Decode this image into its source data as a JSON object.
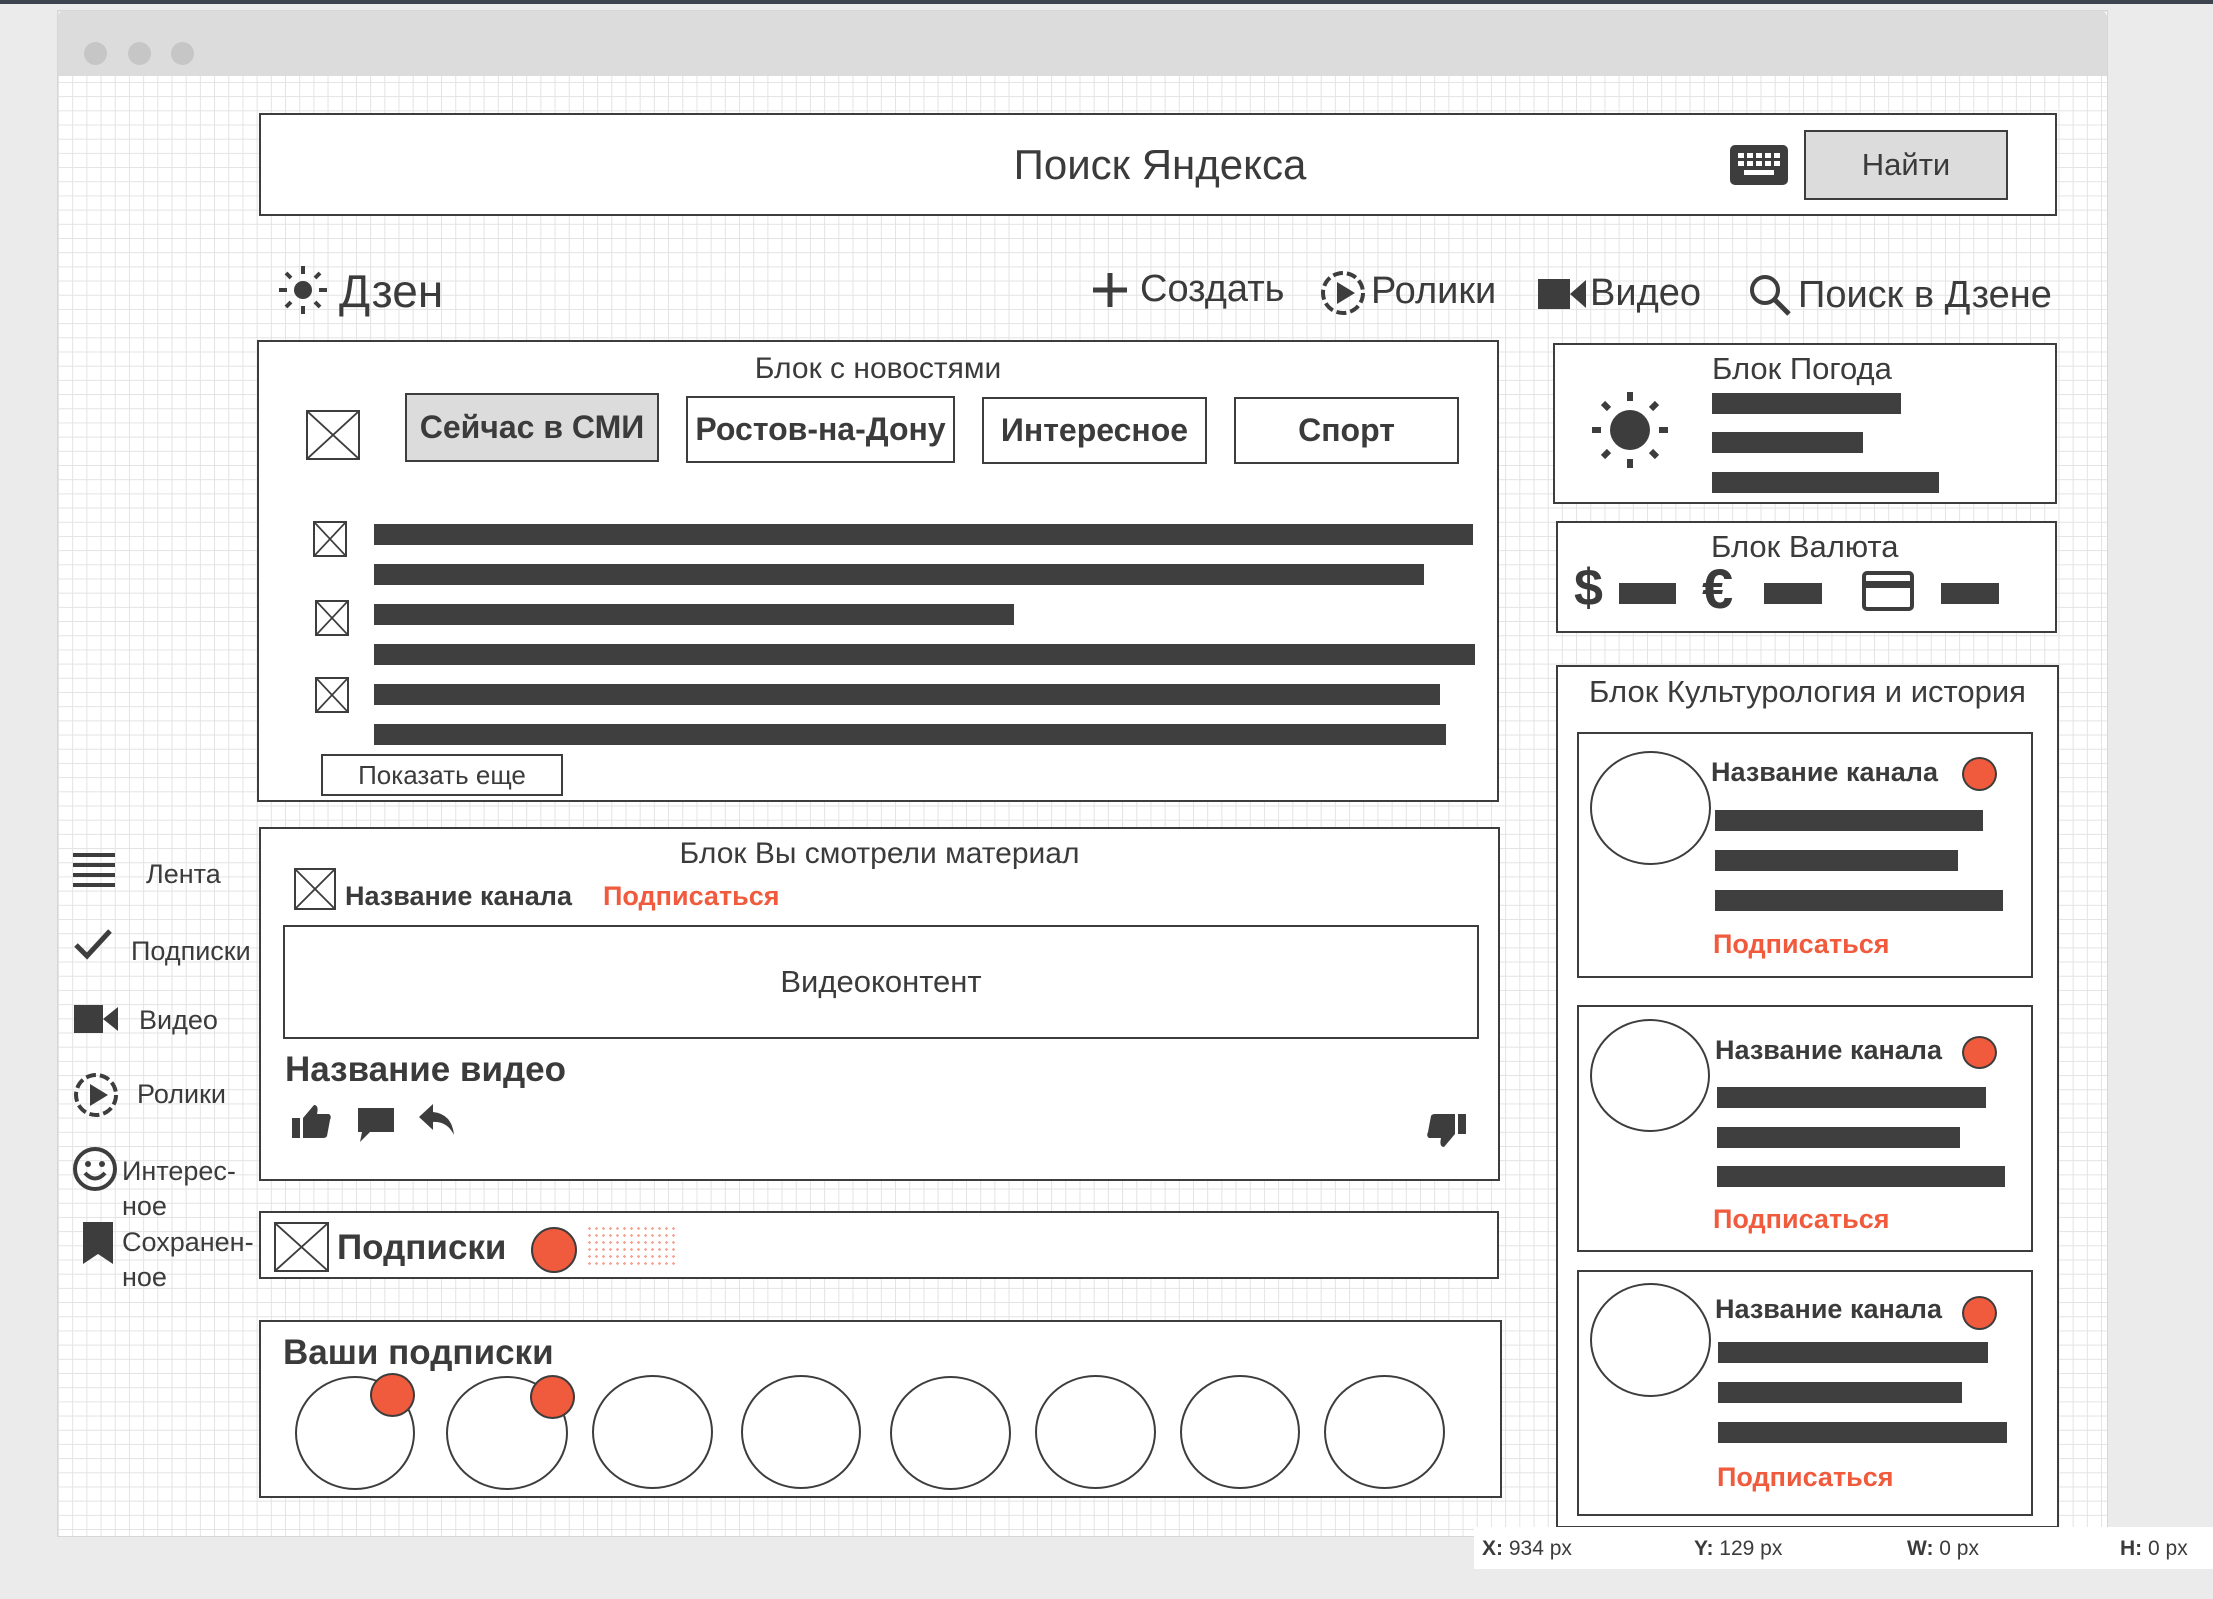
{
  "search": {
    "placeholder": "Поиск Яндекса",
    "button_label": "Найти"
  },
  "nav": {
    "logo_label": "Дзен",
    "create_label": "Создать",
    "clips_label": "Ролики",
    "video_label": "Видео",
    "search_label": "Поиск в Дзене"
  },
  "sidebar": {
    "items": [
      {
        "label": "Лента",
        "icon": "menu-icon"
      },
      {
        "label": "Подписки",
        "icon": "checkmark-icon"
      },
      {
        "label": "Видео",
        "icon": "video-camera-icon"
      },
      {
        "label": "Ролики",
        "icon": "play-circle-icon"
      },
      {
        "label": "Интерес-\nное",
        "icon": "smiley-icon"
      },
      {
        "label": "Сохранен-\nное",
        "icon": "bookmark-icon"
      }
    ]
  },
  "news_block": {
    "title": "Блок с новостями",
    "tabs": [
      "Сейчас в СМИ",
      "Ростов-на-Дону",
      "Интересное",
      "Спорт"
    ],
    "show_more_label": "Показать еще"
  },
  "watched_block": {
    "title": "Блок Вы смотрели материал",
    "channel_name": "Название канала",
    "subscribe_label": "Подписаться",
    "video_placeholder": "Видеоконтент",
    "video_title": "Название видео"
  },
  "subs_bar": {
    "title": "Подписки"
  },
  "your_subs": {
    "title": "Ваши подписки"
  },
  "weather_block": {
    "title": "Блок Погода"
  },
  "currency_block": {
    "title": "Блок Валюта",
    "dollar_symbol": "$",
    "euro_symbol": "€"
  },
  "culture_block": {
    "title": "Блок Культурология и история",
    "cards": [
      {
        "channel_name": "Название канала",
        "subscribe_label": "Подписаться"
      },
      {
        "channel_name": "Название канала",
        "subscribe_label": "Подписаться"
      },
      {
        "channel_name": "Название канала",
        "subscribe_label": "Подписаться"
      }
    ]
  },
  "status": {
    "x_label": "X:",
    "x_value": "934 px",
    "y_label": "Y:",
    "y_value": "129 px",
    "w_label": "W:",
    "w_value": "0 px",
    "h_label": "H:",
    "h_value": "0 px"
  },
  "colors": {
    "accent": "#f05a3d",
    "ink": "#3d3d3d",
    "tab_selected": "#dcdcdc"
  }
}
